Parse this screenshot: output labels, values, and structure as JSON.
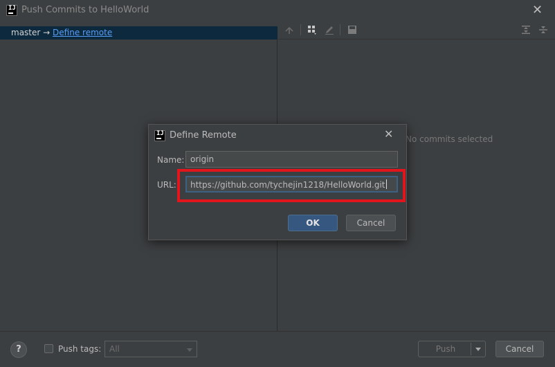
{
  "window": {
    "title": "Push Commits to HelloWorld",
    "icon": "intellij-icon"
  },
  "left_pane": {
    "branch": "master",
    "arrow": "→",
    "define_remote_link": "Define remote"
  },
  "right_pane": {
    "toolbar_icons": [
      "merge-icon",
      "group-icon",
      "edit-icon",
      "save-icon",
      "expand-all-icon",
      "collapse-all-icon"
    ],
    "empty_text": "No commits selected"
  },
  "bottom": {
    "help_label": "?",
    "push_tags_label": "Push tags:",
    "tags_combo_value": "All",
    "push_button": "Push",
    "cancel_button": "Cancel"
  },
  "dialog": {
    "title": "Define Remote",
    "name_label": "Name:",
    "name_value": "origin",
    "url_label": "URL:",
    "url_value": "https://github.com/tychejin1218/HelloWorld.git",
    "ok_button": "OK",
    "cancel_button": "Cancel",
    "highlight_color": "#e3151c"
  }
}
